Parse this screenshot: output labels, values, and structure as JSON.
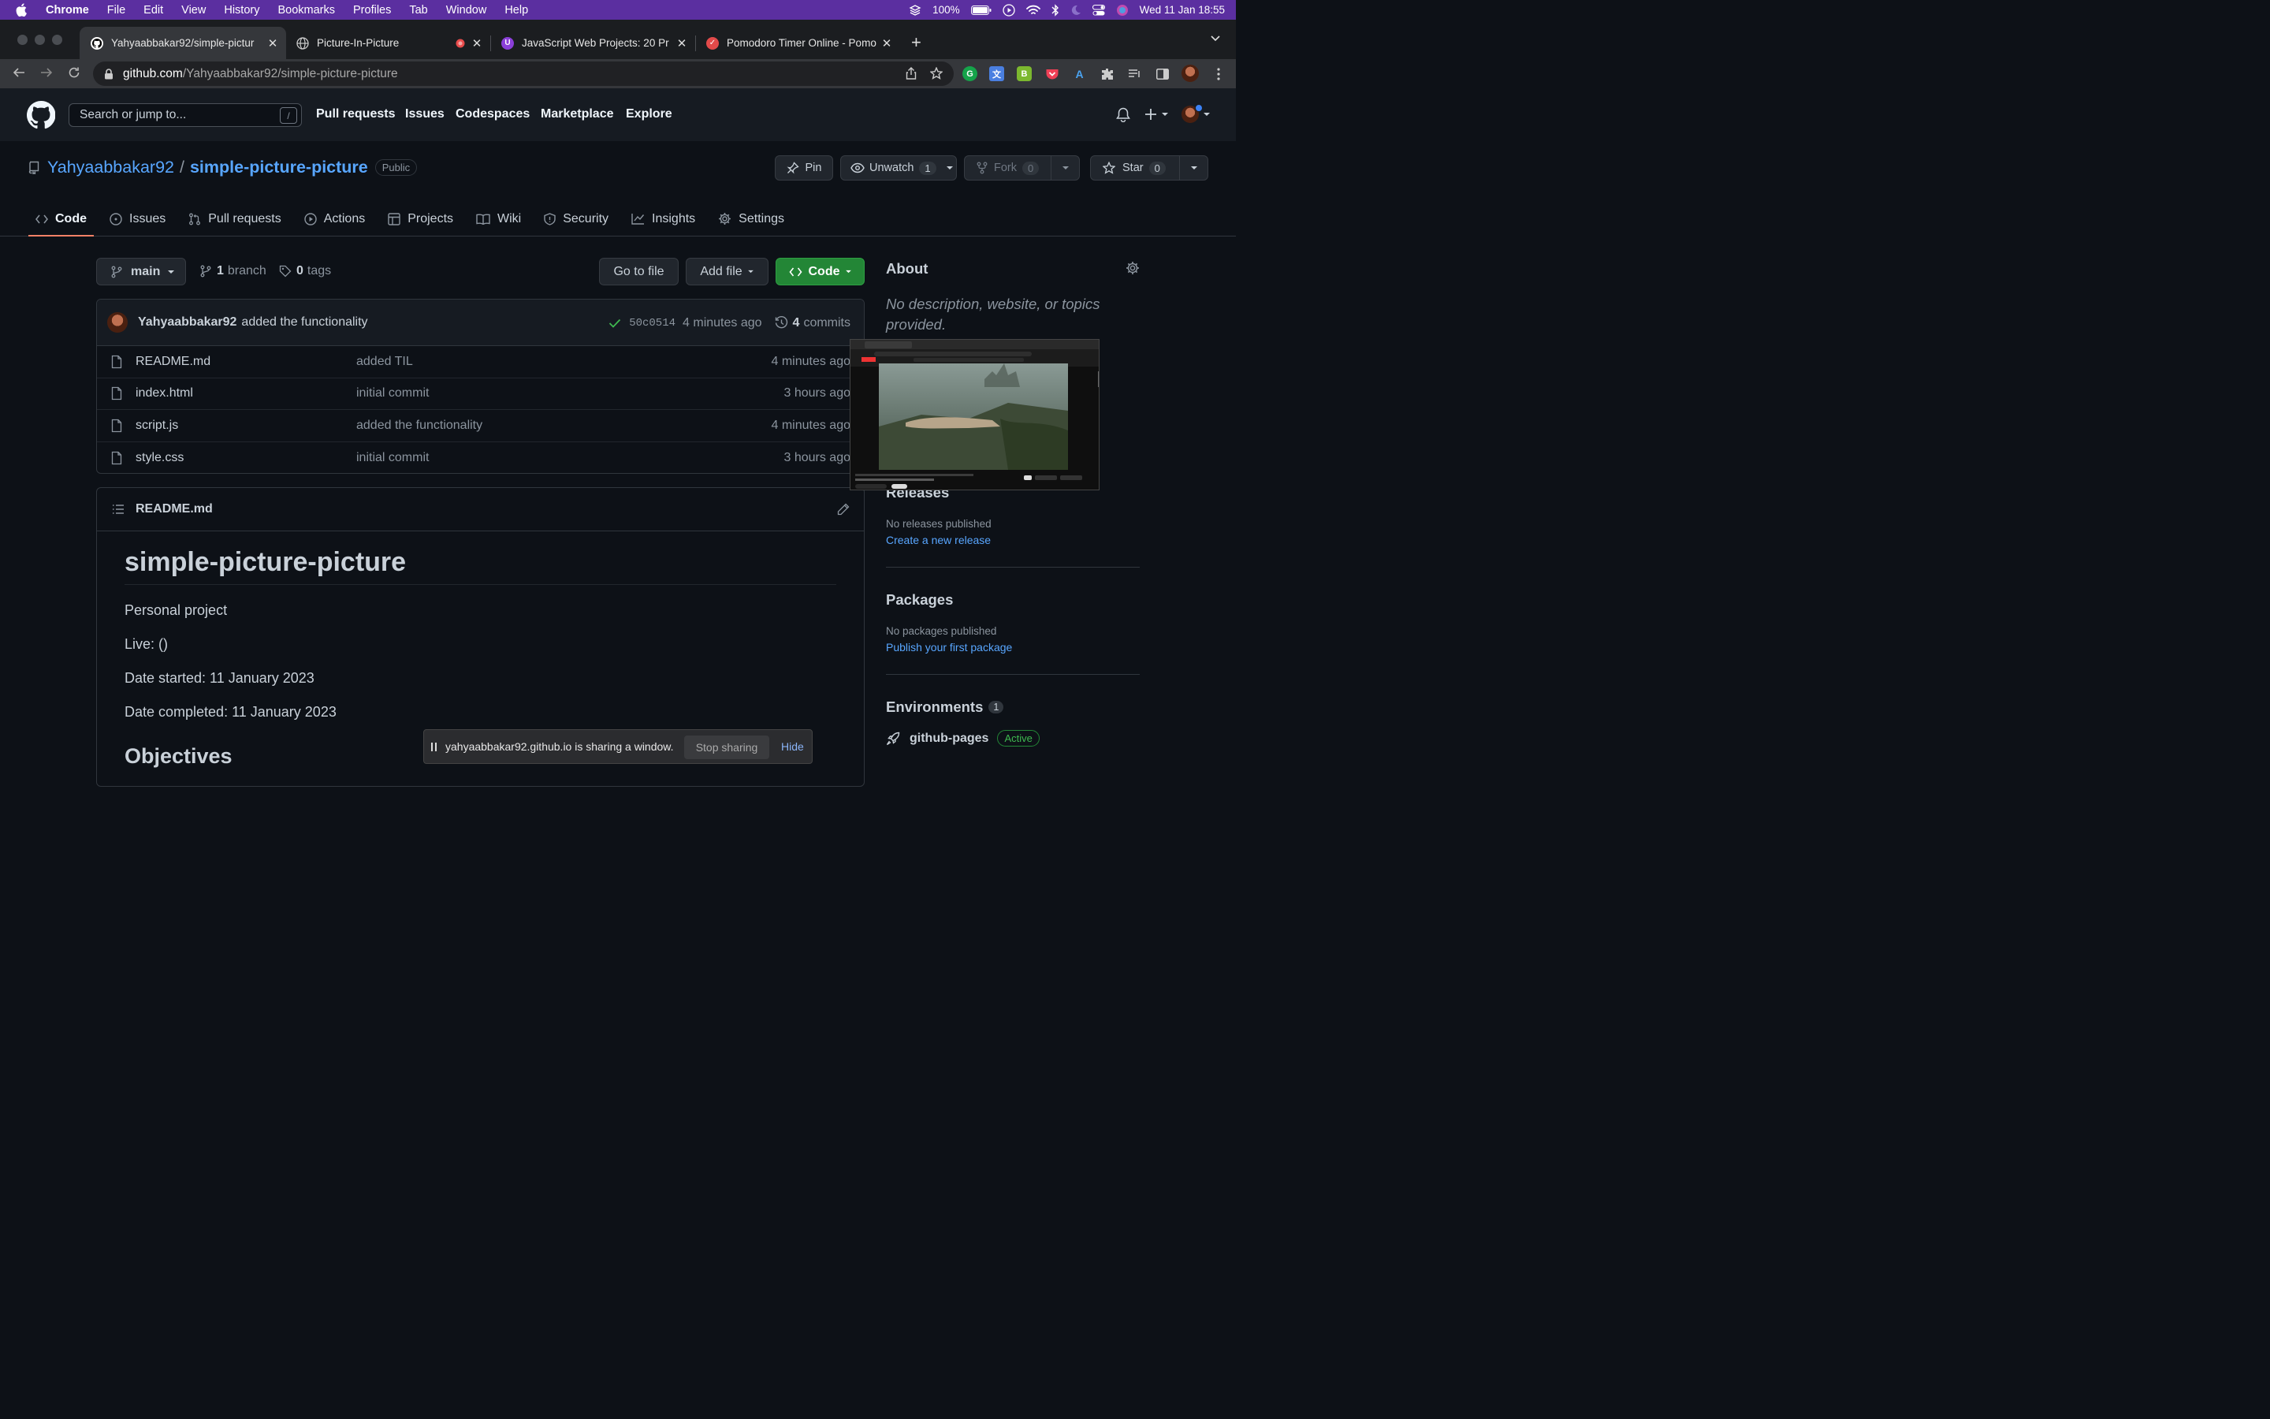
{
  "menubar": {
    "app": "Chrome",
    "items": [
      "File",
      "Edit",
      "View",
      "History",
      "Bookmarks",
      "Profiles",
      "Tab",
      "Window",
      "Help"
    ],
    "battery": "100%",
    "datetime": "Wed 11 Jan  18:55"
  },
  "tabs": [
    {
      "title": "Yahyaabbakar92/simple-pictur",
      "active": true
    },
    {
      "title": "Picture-In-Picture"
    },
    {
      "title": ""
    },
    {
      "title": "JavaScript Web Projects: 20 Pr"
    },
    {
      "title": "Pomodoro Timer Online - Pomo"
    }
  ],
  "address": {
    "host": "github.com",
    "path": "/Yahyaabbakar92/simple-picture-picture"
  },
  "gh_header": {
    "search_placeholder": "Search or jump to...",
    "slash": "/",
    "nav": [
      "Pull requests",
      "Issues",
      "Codespaces",
      "Marketplace",
      "Explore"
    ]
  },
  "repo": {
    "owner": "Yahyaabbakar92",
    "separator": "/",
    "name": "simple-picture-picture",
    "visibility": "Public",
    "pin_label": "Pin",
    "watch_label": "Unwatch",
    "watch_count": "1",
    "fork_label": "Fork",
    "fork_count": "0",
    "star_label": "Star",
    "star_count": "0"
  },
  "repo_tabs": [
    "Code",
    "Issues",
    "Pull requests",
    "Actions",
    "Projects",
    "Wiki",
    "Security",
    "Insights",
    "Settings"
  ],
  "branch": {
    "name": "main",
    "branch_count": "1",
    "branch_label": "branch",
    "tag_count": "0",
    "tag_label": "tags"
  },
  "actions": {
    "go_to_file": "Go to file",
    "add_file": "Add file",
    "code": "Code"
  },
  "latest_commit": {
    "author": "Yahyaabbakar92",
    "message": "added the functionality",
    "sha": "50c0514",
    "age": "4 minutes ago",
    "commit_count": "4",
    "commit_label": "commits"
  },
  "files": [
    {
      "name": "README.md",
      "message": "added TIL",
      "age": "4 minutes ago"
    },
    {
      "name": "index.html",
      "message": "initial commit",
      "age": "3 hours ago"
    },
    {
      "name": "script.js",
      "message": "added the functionality",
      "age": "4 minutes ago"
    },
    {
      "name": "style.css",
      "message": "initial commit",
      "age": "3 hours ago"
    }
  ],
  "readme": {
    "filename": "README.md",
    "h1": "simple-picture-picture",
    "lines": [
      "Personal project",
      "Live: ()",
      "Date started: 11 January 2023",
      "Date completed: 11 January 2023"
    ],
    "h2": "Objectives"
  },
  "about": {
    "title": "About",
    "description": "No description, website, or topics provided."
  },
  "releases": {
    "title": "Releases",
    "none": "No releases published",
    "link": "Create a new release"
  },
  "packages": {
    "title": "Packages",
    "none": "No packages published",
    "link": "Publish your first package"
  },
  "environments": {
    "title": "Environments",
    "count": "1",
    "name": "github-pages",
    "status": "Active"
  },
  "share_bar": {
    "message": "yahyaabbakar92.github.io is sharing a window.",
    "stop": "Stop sharing",
    "hide": "Hide"
  },
  "colors": {
    "accent_link": "#58a6ff",
    "green_button": "#238636",
    "header": "#161b22",
    "background": "#0d1117",
    "menubar": "#5b2fa0"
  }
}
